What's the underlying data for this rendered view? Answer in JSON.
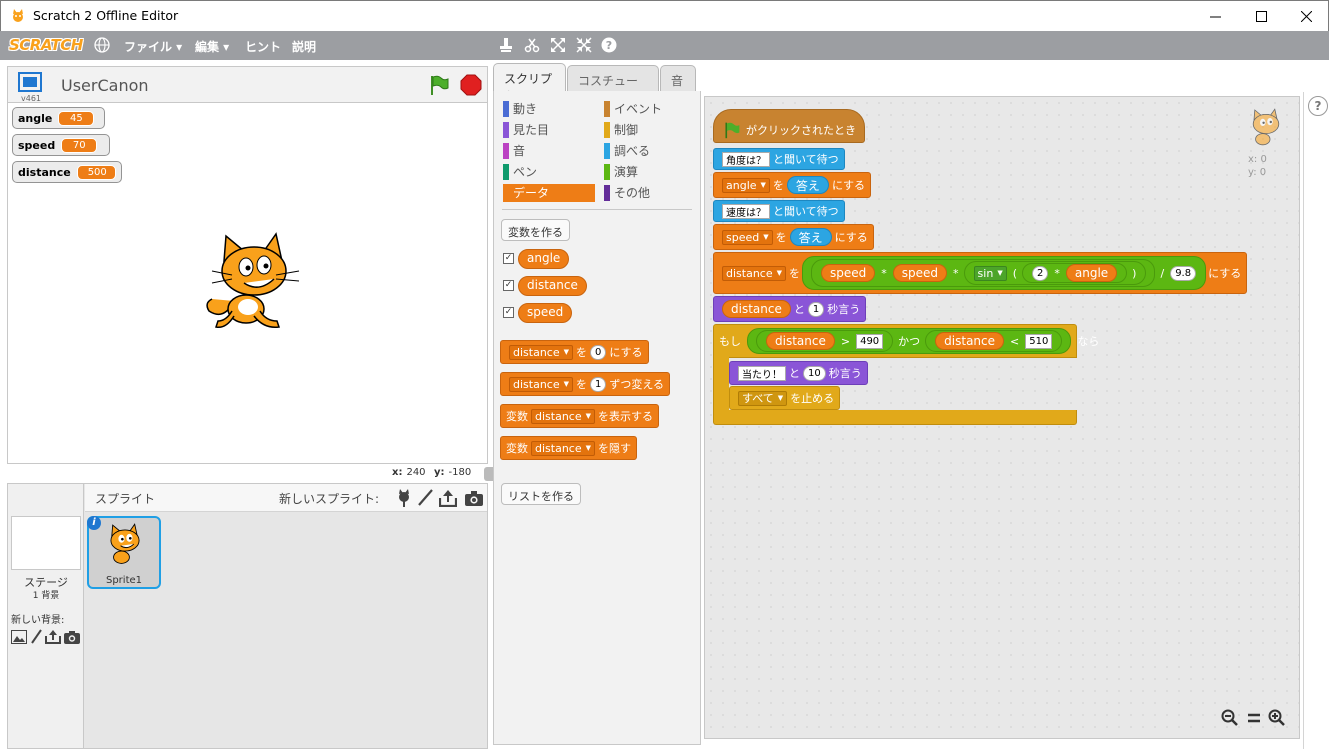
{
  "window": {
    "title": "Scratch 2 Offline Editor"
  },
  "menubar": {
    "logo": "SCRATCH",
    "items": [
      "ファイル ▾",
      "編集 ▾",
      "ヒント",
      "説明"
    ]
  },
  "stage_header": {
    "version": "v461",
    "sprite_name": "UserCanon"
  },
  "monitors": [
    {
      "label": "angle",
      "value": "45"
    },
    {
      "label": "speed",
      "value": "70"
    },
    {
      "label": "distance",
      "value": "500"
    }
  ],
  "stage_coords": {
    "x_label": "x:",
    "x": "240",
    "y_label": "y:",
    "y": "-180"
  },
  "sprites_pane": {
    "title": "スプライト",
    "new_sprite": "新しいスプライト:",
    "stage_label": "ステージ",
    "backdrop_count": "1 背景",
    "new_backdrop": "新しい背景:",
    "sprite1": "Sprite1"
  },
  "tabs": [
    "スクリプト",
    "コスチューム",
    "音"
  ],
  "categories_left": [
    "動き",
    "見た目",
    "音",
    "ペン",
    "データ"
  ],
  "categories_right": [
    "イベント",
    "制御",
    "調べる",
    "演算",
    "その他"
  ],
  "category_colors": {
    "motion": "#4a6cd4",
    "looks": "#8a55d7",
    "sound": "#bb42c3",
    "pen": "#0e9a6c",
    "data": "#ee7d16",
    "events": "#c88330",
    "control": "#e1a91a",
    "sensing": "#2ca5e2",
    "operators": "#5cb712",
    "more": "#632d99"
  },
  "palette": {
    "make_variable": "変数を作る",
    "vars": [
      "angle",
      "distance",
      "speed"
    ],
    "check": "✓",
    "set_block": {
      "var": "distance",
      "pre": "を",
      "val": "0",
      "post": "にする"
    },
    "change_block": {
      "var": "distance",
      "pre": "を",
      "val": "1",
      "post": "ずつ変える"
    },
    "show_block": {
      "pre": "変数",
      "var": "distance",
      "post": "を表示する"
    },
    "hide_block": {
      "pre": "変数",
      "var": "distance",
      "post": "を隠す"
    },
    "make_list": "リストを作る"
  },
  "script": {
    "hat": "がクリックされたとき",
    "ask1": {
      "q": "角度は？",
      "post": "と聞いて待つ"
    },
    "set_angle": {
      "var": "angle",
      "pre": "を",
      "rep": "答え",
      "post": "にする"
    },
    "ask2": {
      "q": "速度は？",
      "post": "と聞いて待つ"
    },
    "set_speed": {
      "var": "speed",
      "pre": "を",
      "rep": "答え",
      "post": "にする"
    },
    "set_dist": {
      "var": "distance",
      "pre": "を",
      "a": "speed",
      "times1": "*",
      "b": "speed",
      "times2": "*",
      "fn": "sin",
      "lp": "(",
      "n": "2",
      "times3": "*",
      "c": "angle",
      "rp": ")",
      "div": "/",
      "d": "9.8",
      "post": "にする"
    },
    "say1": {
      "var": "distance",
      "pre": "と",
      "secs": "1",
      "post": "秒言う"
    },
    "if_block": {
      "pre": "もし",
      "a": "distance",
      "gt": ">",
      "v1": "490",
      "and": "かつ",
      "b": "distance",
      "lt": "<",
      "v2": "510",
      "post": "なら"
    },
    "say2": {
      "msg": "当たり！",
      "pre": "と",
      "secs": "10",
      "post": "秒言う"
    },
    "stop": {
      "opt": "すべて",
      "post": "を止める"
    }
  },
  "script_area": {
    "x": "x: 0",
    "y": "y: 0"
  },
  "help": "?"
}
